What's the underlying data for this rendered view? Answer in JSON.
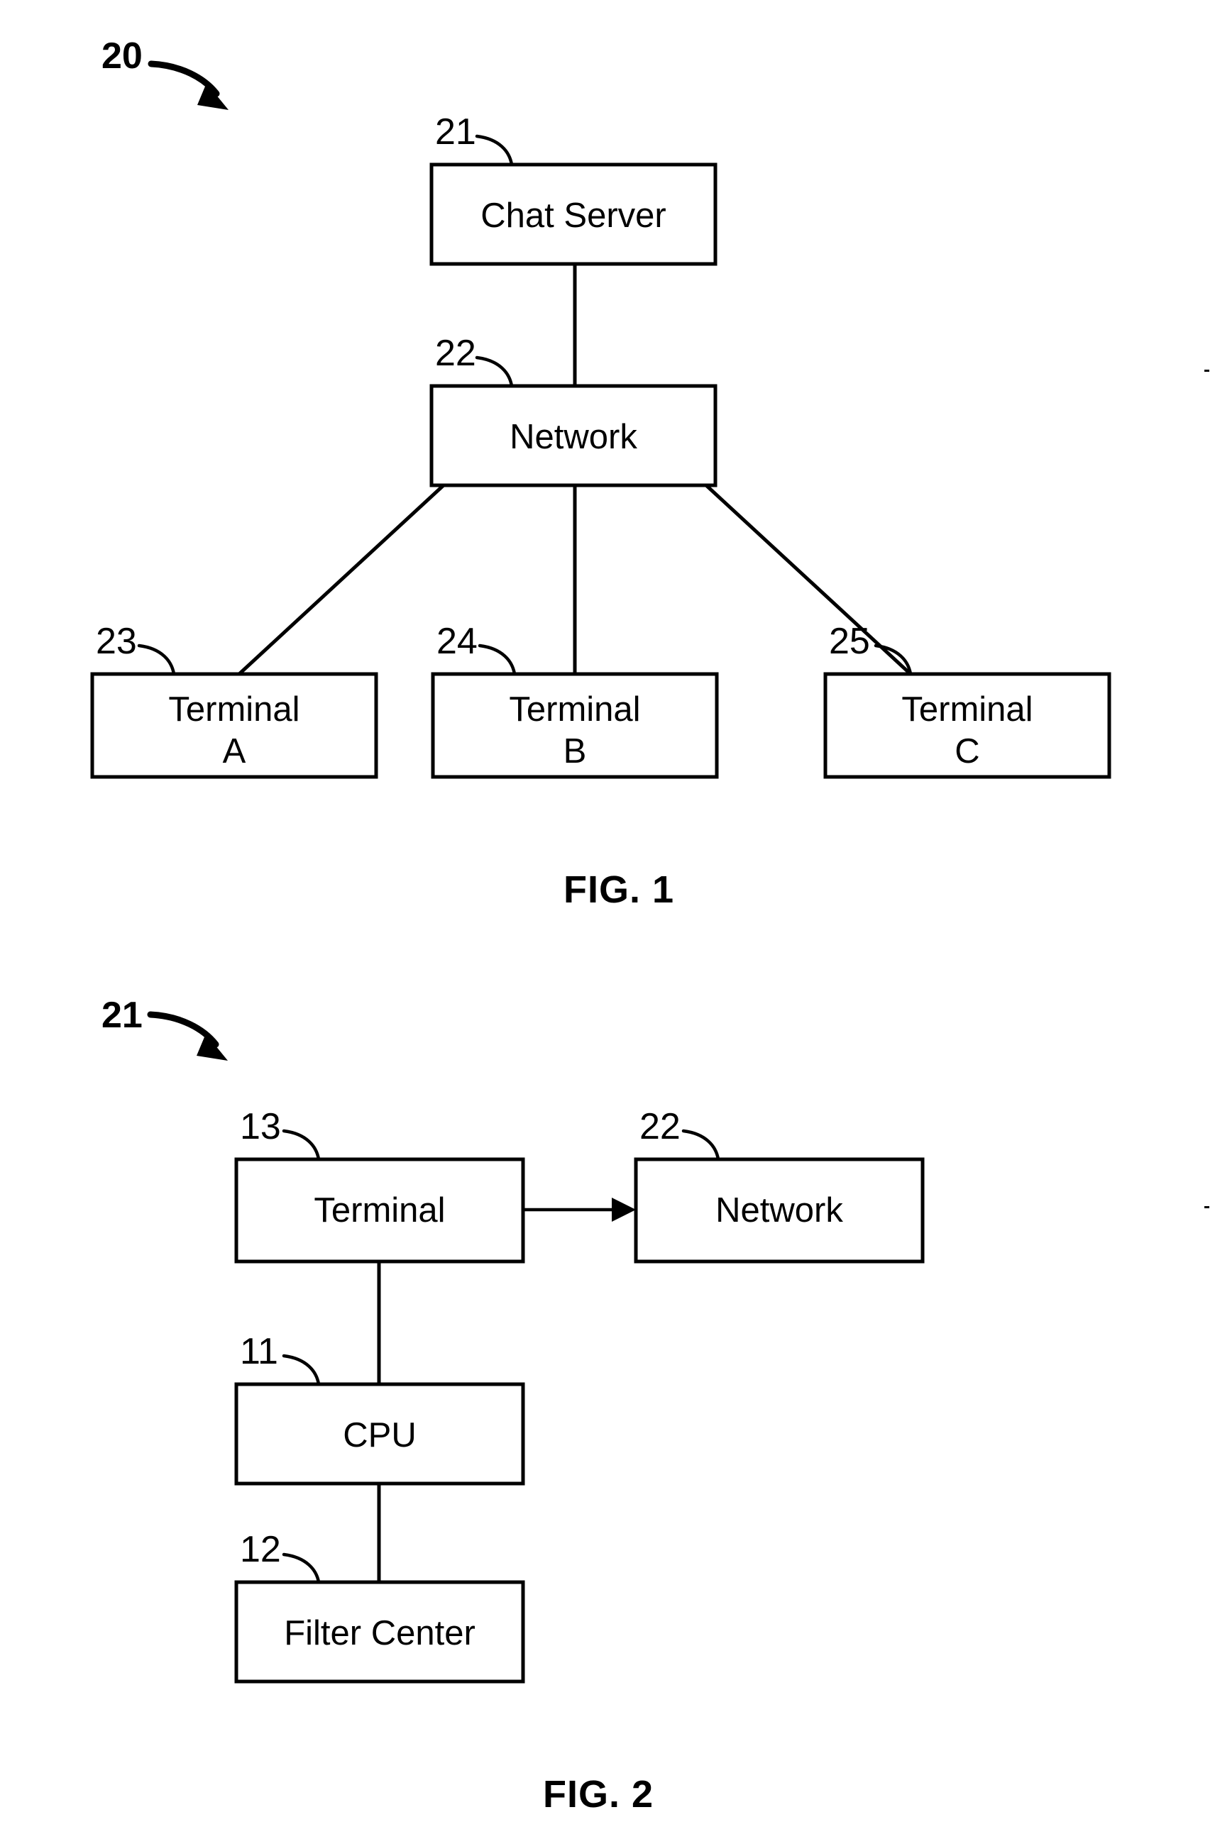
{
  "document": {
    "type": "patent-drawing-sheet",
    "background_color": "#ffffff",
    "line_color": "#000000"
  },
  "figures": [
    {
      "id": "fig1",
      "caption": "FIG. 1",
      "system_ref": "20",
      "nodes": [
        {
          "id": "chat_server",
          "label": "Chat Server",
          "ref": "21"
        },
        {
          "id": "network",
          "label": "Network",
          "ref": "22"
        },
        {
          "id": "terminal_a",
          "label": "Terminal",
          "label2": "A",
          "ref": "23"
        },
        {
          "id": "terminal_b",
          "label": "Terminal",
          "label2": "B",
          "ref": "24"
        },
        {
          "id": "terminal_c",
          "label": "Terminal",
          "label2": "C",
          "ref": "25"
        }
      ],
      "edges": [
        {
          "from": "chat_server",
          "to": "network",
          "arrow": false
        },
        {
          "from": "network",
          "to": "terminal_a",
          "arrow": false
        },
        {
          "from": "network",
          "to": "terminal_b",
          "arrow": false
        },
        {
          "from": "network",
          "to": "terminal_c",
          "arrow": false
        }
      ]
    },
    {
      "id": "fig2",
      "caption": "FIG. 2",
      "system_ref": "21",
      "nodes": [
        {
          "id": "terminal",
          "label": "Terminal",
          "ref": "13"
        },
        {
          "id": "network2",
          "label": "Network",
          "ref": "22"
        },
        {
          "id": "cpu",
          "label": "CPU",
          "ref": "11"
        },
        {
          "id": "filter_center",
          "label": "Filter Center",
          "ref": "12"
        }
      ],
      "edges": [
        {
          "from": "terminal",
          "to": "network2",
          "arrow": true
        },
        {
          "from": "terminal",
          "to": "cpu",
          "arrow": false
        },
        {
          "from": "cpu",
          "to": "filter_center",
          "arrow": false
        }
      ]
    }
  ]
}
